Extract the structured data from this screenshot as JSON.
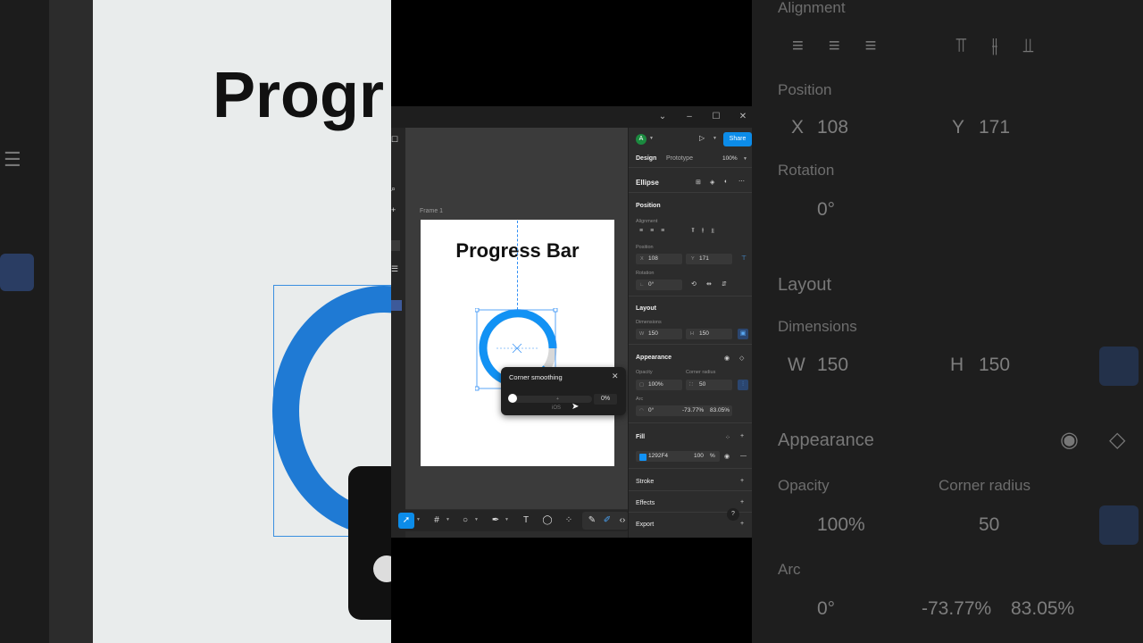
{
  "background": {
    "left_title": "Progr",
    "right": {
      "alignment_label": "Alignment",
      "position_label": "Position",
      "x_label": "X",
      "x_value": "108",
      "y_label": "Y",
      "y_value": "171",
      "rotation_label": "Rotation",
      "rotation_value": "0°",
      "layout_label": "Layout",
      "dimensions_label": "Dimensions",
      "w_label": "W",
      "w_value": "150",
      "h_label": "H",
      "h_value": "150",
      "appearance_label": "Appearance",
      "opacity_label": "Opacity",
      "opacity_value": "100%",
      "corner_radius_label": "Corner radius",
      "corner_radius_value": "50",
      "arc_label": "Arc",
      "arc_start": "0°",
      "arc_sweep": "-73.77%",
      "arc_ratio": "83.05%"
    }
  },
  "canvas": {
    "frame_label": "Frame 1",
    "frame_title": "Progress Bar",
    "ring_color": "#1292f4",
    "popup": {
      "title": "Corner smoothing",
      "value": "0%",
      "preset": "iOS"
    }
  },
  "panel": {
    "avatar_letter": "A",
    "share_label": "Share",
    "tab_design": "Design",
    "tab_prototype": "Prototype",
    "zoom": "100%",
    "layer_name": "Ellipse",
    "position_title": "Position",
    "alignment_label": "Alignment",
    "position_label": "Position",
    "x_label": "X",
    "x_value": "108",
    "y_label": "Y",
    "y_value": "171",
    "rotation_label": "Rotation",
    "rotation_value": "0°",
    "layout_title": "Layout",
    "dimensions_label": "Dimensions",
    "w_label": "W",
    "w_value": "150",
    "h_label": "H",
    "h_value": "150",
    "appearance_title": "Appearance",
    "opacity_label": "Opacity",
    "opacity_value": "100%",
    "corner_radius_label": "Corner radius",
    "corner_radius_value": "50",
    "arc_label": "Arc",
    "arc_start": "0°",
    "arc_sweep": "-73.77%",
    "arc_ratio": "83.05%",
    "fill_title": "Fill",
    "fill_hex": "1292F4",
    "fill_opacity": "100",
    "fill_pct": "%",
    "fill_color": "#1292f4",
    "stroke_title": "Stroke",
    "effects_title": "Effects",
    "export_title": "Export",
    "help": "?"
  }
}
